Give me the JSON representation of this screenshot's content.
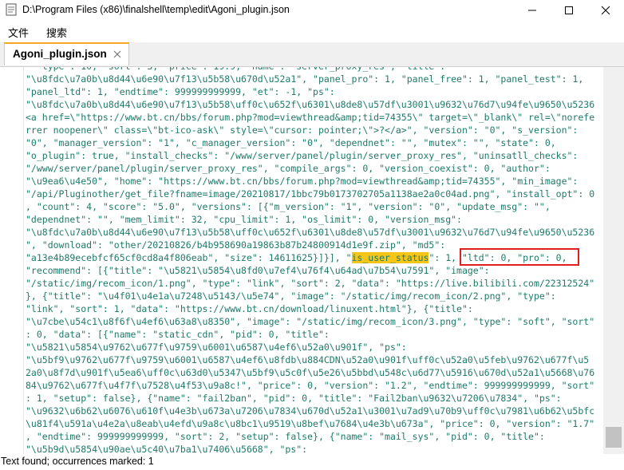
{
  "window": {
    "title": "D:\\Program Files (x86)\\finalshell\\temp\\edit\\Agoni_plugin.json",
    "app_icon": "notepad-icon",
    "controls": [
      "minimize-icon",
      "maximize-icon",
      "close-icon"
    ]
  },
  "menu": {
    "items": [
      "文件",
      "搜索"
    ]
  },
  "tabs": [
    {
      "label": "Agoni_plugin.json",
      "close_icon": "close-icon",
      "accent": "#f5a623"
    }
  ],
  "editor": {
    "lines": [
      "  \"type\": 10, \"sort\": 3, \"price\": 19.9, \"name\": \"server_proxy_res\", \"title\":",
      "\"\\u8fdc\\u7a0b\\u8d44\\u6e90\\u7f13\\u5b58\\u670d\\u52a1\", \"panel_pro\": 1, \"panel_free\": 1, \"panel_test\": 1,",
      "\"panel_ltd\": 1, \"endtime\": 999999999999, \"et\": -1, \"ps\":",
      "\"\\u8fdc\\u7a0b\\u8d44\\u6e90\\u7f13\\u5b58\\uff0c\\u652f\\u6301\\u8de8\\u57df\\u3001\\u9632\\u76d7\\u94fe\\u9650\\u5236",
      "<a href=\\\"https://www.bt.cn/bbs/forum.php?mod=viewthread&amp;tid=74355\\\" target=\\\"_blank\\\" rel=\\\"norefe",
      "rrer noopener\\\" class=\\\"bt-ico-ask\\\" style=\\\"cursor: pointer;\\\">?</a>\", \"version\": \"0\", \"s_version\":",
      "\"0\", \"manager_version\": \"1\", \"c_manager_version\": \"0\", \"dependnet\": \"\", \"mutex\": \"\", \"state\": 0,",
      "\"o_plugin\": true, \"install_checks\": \"/www/server/panel/plugin/server_proxy_res\", \"uninsatll_checks\":",
      "\"/www/server/panel/plugin/server_proxy_res\", \"compile_args\": 0, \"version_coexist\": 0, \"author\":",
      "\"\\u9ea6\\u4e50\", \"home\": \"https://www.bt.cn/bbs/forum.php?mod=viewthread&amp;tid=74355\", \"min_image\":",
      "\"/api/Pluginother/get_file?fname=image/20210817/1bbc79b0173702705a1138ae2a0c04ad.png\", \"install_opt\": 0",
      ", \"count\": 4, \"score\": \"5.0\", \"versions\": [{\"m_version\": \"1\", \"version\": \"0\", \"update_msg\": \"\",",
      "\"dependnet\": \"\", \"mem_limit\": 32, \"cpu_limit\": 1, \"os_limit\": 0, \"version_msg\":",
      "\"\\u8fdc\\u7a0b\\u8d44\\u6e90\\u7f13\\u5b58\\uff0c\\u652f\\u6301\\u8de8\\u57df\\u3001\\u9632\\u76d7\\u94fe\\u9650\\u5236",
      "\", \"download\": \"other/20210826/b4b958690a19863b87b24800914d1e9f.zip\", \"md5\":",
      "\"a13e4b89ecebfcf65cf0cd8a4f806eab\", \"size\": 14611625}]}], \"is_user_status\": 1, \"ltd\": 0, \"pro\": 0,",
      "\"recommend\": [{\"title\": \"\\u5821\\u5854\\u8fd0\\u7ef4\\u76f4\\u64ad\\u7b54\\u7591\", \"image\":",
      "\"/static/img/recom_icon/1.png\", \"type\": \"link\", \"sort\": 2, \"data\": \"https://live.bilibili.com/22312524\"",
      "}, {\"title\": \"\\u4f01\\u4e1a\\u7248\\u5143/\\u5e74\", \"image\": \"/static/img/recom_icon/2.png\", \"type\":",
      "\"link\", \"sort\": 1, \"data\": \"https://www.bt.cn/download/linuxent.html\"}, {\"title\":",
      "\"\\u7cbe\\u54c1\\u8f6f\\u4ef6\\u63a8\\u8350\", \"image\": \"/static/img/recom_icon/3.png\", \"type\": \"soft\", \"sort\"",
      ": 0, \"data\": [{\"name\": \"static_cdn\", \"pid\": 0, \"title\":",
      "\"\\u5821\\u5854\\u9762\\u677f\\u9759\\u6001\\u6587\\u4ef6\\u52a0\\u901f\", \"ps\":",
      "\"\\u5bf9\\u9762\\u677f\\u9759\\u6001\\u6587\\u4ef6\\u8fdb\\u884CDN\\u52a0\\u901f\\uff0c\\u52a0\\u5feb\\u9762\\u677f\\u5",
      "2a0\\u8f7d\\u901f\\u5ea6\\uff0c\\u63d0\\u5347\\u5bf9\\u5c0f\\u5e26\\u5bbd\\u548c\\u6d77\\u5916\\u670d\\u52a1\\u5668\\u76",
      "84\\u9762\\u677f\\u4f7f\\u7528\\u4f53\\u9a8c!\", \"price\": 0, \"version\": \"1.2\", \"endtime\": 999999999999, \"sort\"",
      ": 1, \"setup\": false}, {\"name\": \"fail2ban\", \"pid\": 0, \"title\": \"Fail2ban\\u9632\\u7206\\u7834\", \"ps\":",
      "\"\\u9632\\u6b62\\u6076\\u610f\\u4e3b\\u673a\\u7206\\u7834\\u670d\\u52a1\\u3001\\u7ad9\\u70b9\\uff0c\\u7981\\u6b62\\u5bfc",
      "\\u81f4\\u591a\\u4e2a\\u8eab\\u4efd\\u9a8c\\u8bc1\\u9519\\u8bef\\u7684\\u4e3b\\u673a\", \"price\": 0, \"version\": \"1.7\"",
      ", \"endtime\": 999999999999, \"sort\": 2, \"setup\": false}, {\"name\": \"mail_sys\", \"pid\": 0, \"title\":",
      "\"\\u5b9d\\u5854\\u90ae\\u5c40\\u7ba1\\u7406\\u5668\", \"ps\":"
    ],
    "highlight": {
      "line": 15,
      "text": "is_user_status",
      "color": "#f5c518"
    },
    "text_color": "#1f7a6a",
    "match_box_color": "#e01e1e"
  },
  "status": {
    "text": "Text found; occurrences marked: 1"
  }
}
